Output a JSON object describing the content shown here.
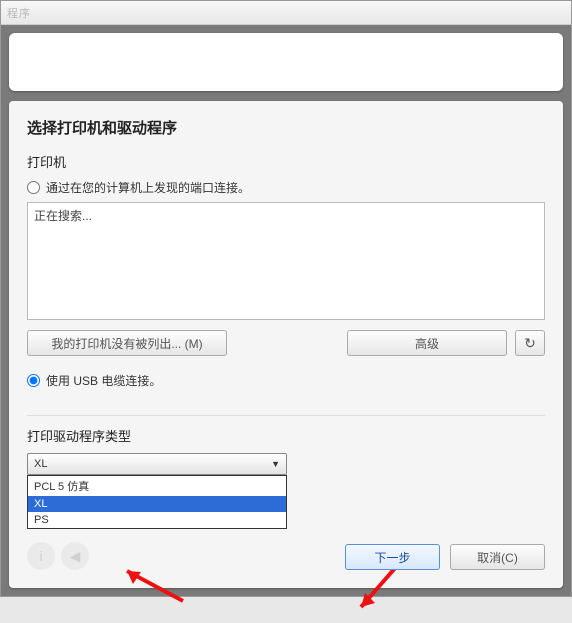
{
  "titlebar": {
    "text": "程序"
  },
  "section_title": "选择打印机和驱动程序",
  "printer_label": "打印机",
  "radio_network": "通过在您的计算机上发现的端口连接。",
  "radio_usb": "使用 USB 电缆连接。",
  "searching_text": "正在搜索...",
  "btn_not_listed": "我的打印机没有被列出... (M)",
  "btn_advanced": "高级",
  "driver_type_label": "打印驱动程序类型",
  "dropdown": {
    "selected": "XL",
    "options": [
      "PCL 5 仿真",
      "XL",
      "PS"
    ]
  },
  "btn_next": "下一步",
  "btn_cancel": "取消(C)"
}
